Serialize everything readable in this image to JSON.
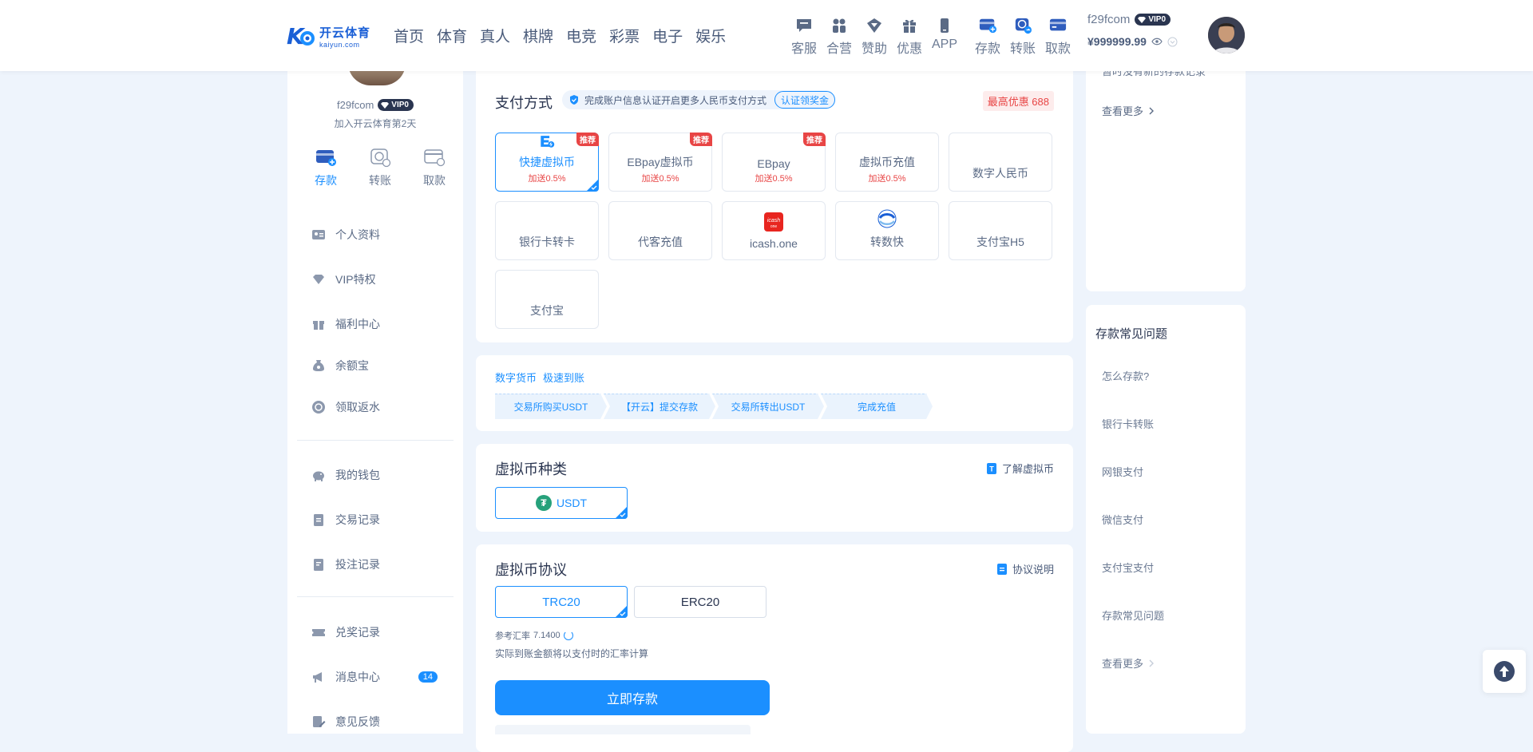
{
  "header": {
    "logo_cn": "开云体育",
    "logo_en": "kaiyun.com",
    "nav": [
      "首页",
      "体育",
      "真人",
      "棋牌",
      "电竞",
      "彩票",
      "电子",
      "娱乐"
    ],
    "quick_links": [
      {
        "label": "客服",
        "icon": "chat-icon"
      },
      {
        "label": "合营",
        "icon": "partners-icon"
      },
      {
        "label": "赞助",
        "icon": "sponsor-icon"
      },
      {
        "label": "优惠",
        "icon": "gift-icon"
      },
      {
        "label": "APP",
        "icon": "phone-icon"
      }
    ],
    "wallet_links": [
      {
        "label": "存款",
        "icon": "deposit-icon"
      },
      {
        "label": "转账",
        "icon": "transfer-icon"
      },
      {
        "label": "取款",
        "icon": "withdraw-icon"
      }
    ],
    "username": "f29fcom",
    "vip": "VIP0",
    "balance": "¥999999.99"
  },
  "sidebar": {
    "username": "f29fcom",
    "vip": "VIP0",
    "days": "加入开云体育第2天",
    "actions": [
      {
        "label": "存款",
        "active": true
      },
      {
        "label": "转账",
        "active": false
      },
      {
        "label": "取款",
        "active": false
      }
    ],
    "menu_group1": [
      "个人资料",
      "VIP特权",
      "福利中心",
      "余额宝",
      "领取返水"
    ],
    "menu_group2": [
      "我的钱包",
      "交易记录",
      "投注记录"
    ],
    "menu_group3": [
      "兑奖记录",
      "消息中心",
      "意见反馈"
    ],
    "message_count": "14"
  },
  "payment": {
    "title": "支付方式",
    "verify_text": "完成账户信息认证开启更多人民币支付方式",
    "verify_button": "认证领奖金",
    "max_offer": "最高优惠 688",
    "methods": [
      {
        "name": "快捷虚拟币",
        "bonus": "加送0.5%",
        "tag": "推荐",
        "selected": true
      },
      {
        "name": "EBpay虚拟币",
        "bonus": "加送0.5%",
        "tag": "推荐",
        "selected": false
      },
      {
        "name": "EBpay",
        "bonus": "加送0.5%",
        "tag": "推荐",
        "selected": false
      },
      {
        "name": "虚拟币充值",
        "bonus": "加送0.5%",
        "tag": "",
        "selected": false
      },
      {
        "name": "数字人民币",
        "bonus": "",
        "tag": "",
        "selected": false
      },
      {
        "name": "银行卡转卡",
        "bonus": "",
        "tag": "",
        "selected": false
      },
      {
        "name": "代客充值",
        "bonus": "",
        "tag": "",
        "selected": false
      },
      {
        "name": "icash.one",
        "bonus": "",
        "tag": "",
        "selected": false
      },
      {
        "name": "转数快",
        "bonus": "",
        "tag": "",
        "selected": false
      },
      {
        "name": "支付宝H5",
        "bonus": "",
        "tag": "",
        "selected": false
      },
      {
        "name": "支付宝",
        "bonus": "",
        "tag": "",
        "selected": false
      }
    ]
  },
  "steps": {
    "title_a": "数字货币",
    "title_b": "极速到账",
    "items": [
      "交易所购买USDT",
      "【开云】提交存款",
      "交易所转出USDT",
      "完成充值"
    ]
  },
  "coin": {
    "title": "虚拟币种类",
    "link": "了解虚拟币",
    "option": "USDT"
  },
  "protocol": {
    "title": "虚拟币协议",
    "link": "协议说明",
    "options": [
      "TRC20",
      "ERC20"
    ],
    "rate_label": "参考汇率",
    "rate_value": "7.1400",
    "note": "实际到账金额将以支付时的汇率计算",
    "submit": "立即存款"
  },
  "right": {
    "clipped_text": "暂时没有新的存款记录",
    "view_more": "查看更多",
    "faq_title": "存款常见问题",
    "faq": [
      "怎么存款?",
      "银行卡转账",
      "网银支付",
      "微信支付",
      "支付宝支付",
      "存款常见问题"
    ],
    "faq_more": "查看更多"
  },
  "colors": {
    "accent": "#1b8fff",
    "bonus_red": "#e84545",
    "bg": "#eef4fc"
  }
}
